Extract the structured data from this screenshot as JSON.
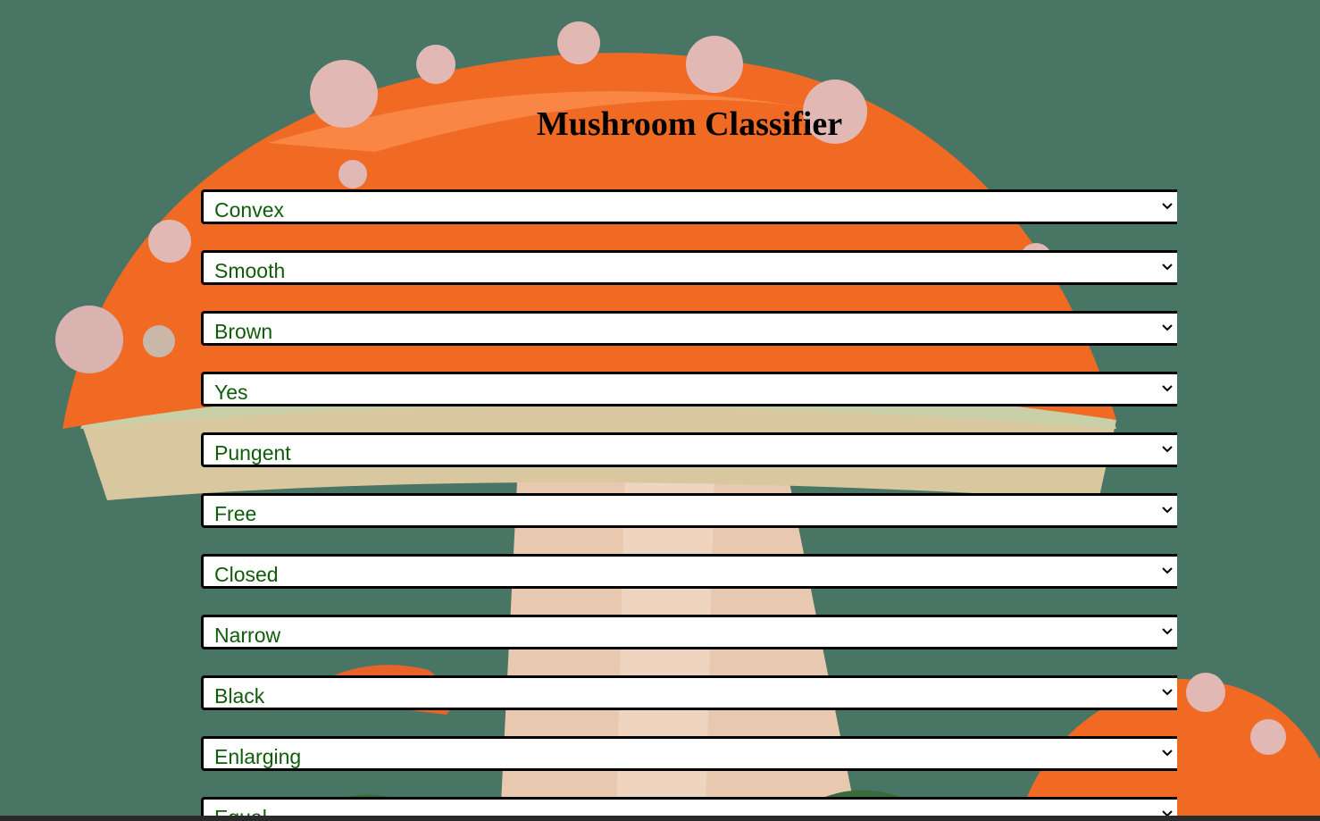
{
  "page": {
    "title": "Mushroom Classifier"
  },
  "form": {
    "fields": [
      {
        "value": "Convex"
      },
      {
        "value": "Smooth"
      },
      {
        "value": "Brown"
      },
      {
        "value": "Yes"
      },
      {
        "value": "Pungent"
      },
      {
        "value": "Free"
      },
      {
        "value": "Closed"
      },
      {
        "value": "Narrow"
      },
      {
        "value": "Black"
      },
      {
        "value": "Enlarging"
      },
      {
        "value": "Equal"
      }
    ]
  },
  "colors": {
    "background": "#487564",
    "select_text": "#0f5c0a",
    "cap_orange": "#f06a24",
    "border": "#000000"
  },
  "icons": {
    "dropdown": "chevron-down-icon"
  }
}
